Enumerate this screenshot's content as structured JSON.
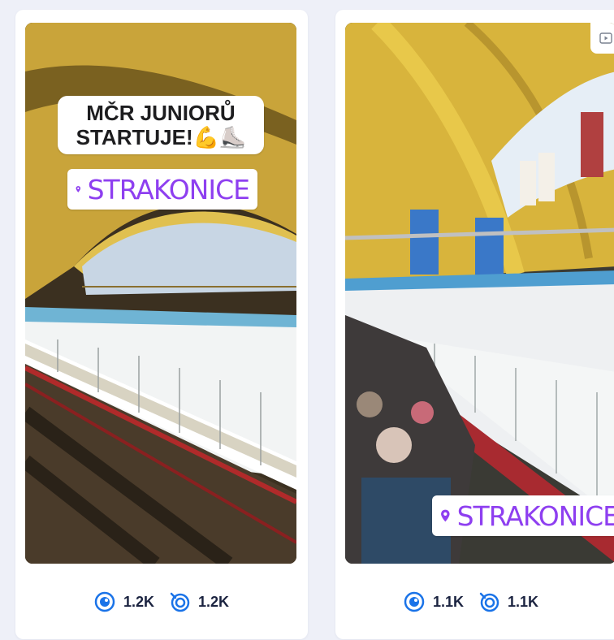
{
  "cards": [
    {
      "title_line1": "MČR JUNIORŮ",
      "title_line2": "STARTUJE!💪⛸️",
      "location": "STRAKONICE",
      "reach": "1.2K",
      "impressions": "1.2K"
    },
    {
      "location": "STRAKONICE",
      "reach": "1.1K",
      "impressions": "1.1K",
      "media_type_icon": "video-icon"
    }
  ],
  "colors": {
    "accent_blue": "#1a73e8",
    "location_purple": "#8e3ff0",
    "stat_text": "#1b2340"
  }
}
